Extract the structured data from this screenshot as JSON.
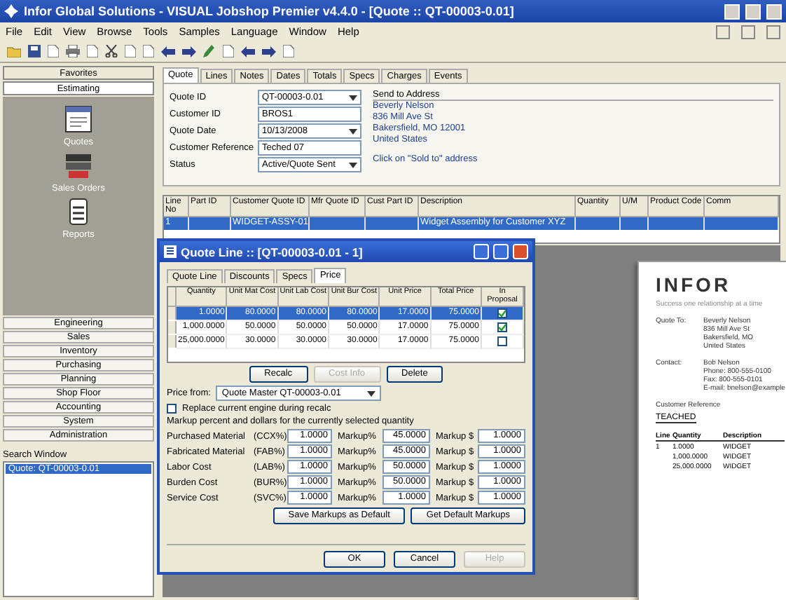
{
  "window": {
    "title": "Infor Global Solutions - VISUAL Jobshop Premier v4.4.0 - [Quote :: QT-00003-0.01]"
  },
  "menu": [
    "File",
    "Edit",
    "View",
    "Browse",
    "Tools",
    "Samples",
    "Language",
    "Window",
    "Help"
  ],
  "sidebar": {
    "headers": [
      {
        "label": "Favorites",
        "selected": false
      },
      {
        "label": "Estimating",
        "selected": true
      }
    ],
    "shortcuts": [
      "Quotes",
      "Sales Orders",
      "Reports"
    ],
    "modules": [
      "Engineering",
      "Sales",
      "Inventory",
      "Purchasing",
      "Planning",
      "Shop Floor",
      "Accounting",
      "System",
      "Administration"
    ],
    "search": {
      "title": "Search Window",
      "items": [
        {
          "label": "Quote: QT-00003-0.01",
          "selected": true
        }
      ]
    }
  },
  "main": {
    "tabs": [
      {
        "label": "Quote",
        "selected": true
      },
      {
        "label": "Lines",
        "selected": false
      },
      {
        "label": "Notes",
        "selected": false
      },
      {
        "label": "Dates",
        "selected": false
      },
      {
        "label": "Totals",
        "selected": false
      },
      {
        "label": "Specs",
        "selected": false
      },
      {
        "label": "Charges",
        "selected": false
      },
      {
        "label": "Events",
        "selected": false
      }
    ],
    "fields": [
      {
        "label": "Quote ID",
        "value": "QT-00003-0.01",
        "kind": "dropdown"
      },
      {
        "label": "Customer ID",
        "value": "BROS1",
        "kind": "text"
      },
      {
        "label": "Quote Date",
        "value": "10/13/2008",
        "kind": "dropdown"
      },
      {
        "label": "Customer Reference",
        "value": "Teched 07",
        "kind": "text"
      },
      {
        "label": "Status",
        "value": "Active/Quote Sent",
        "kind": "dropdown"
      }
    ],
    "address": {
      "title": "Send to Address",
      "lines": [
        "Beverly Nelson",
        "836 Mill Ave St",
        "Bakersfield, MO 12001",
        "United States"
      ],
      "link": "Click on \"Sold to\" address"
    },
    "grid": {
      "columns": [
        "Line No",
        "Part ID",
        "Customer Quote ID",
        "Mfr Quote ID",
        "Cust Part ID",
        "Description",
        "Quantity",
        "U/M",
        "Product Code",
        "Comm"
      ],
      "rows": [
        {
          "cells": [
            "1",
            null,
            "WIDGET-ASSY-01",
            null,
            null,
            "Widget Assembly for Customer XYZ",
            null,
            null,
            null,
            null
          ],
          "selected": true
        }
      ]
    }
  },
  "dialog": {
    "title": "Quote Line :: [QT-00003-0.01 - 1]",
    "tabs": [
      {
        "label": "Quote Line",
        "selected": false
      },
      {
        "label": "Discounts",
        "selected": false
      },
      {
        "label": "Specs",
        "selected": false
      },
      {
        "label": "Price",
        "selected": true
      }
    ],
    "columns": [
      "Quantity",
      "Unit Mat Cost",
      "Unit Lab Cost",
      "Unit Bur Cost",
      "Unit Price",
      "Total Price",
      "In Proposal"
    ],
    "rows": [
      {
        "cells": [
          "1.0000",
          "80.0000",
          "80.0000",
          "80.0000",
          "17.0000",
          "75.0000"
        ],
        "in_proposal": true,
        "selected": true
      },
      {
        "cells": [
          "1,000.0000",
          "50.0000",
          "50.0000",
          "50.0000",
          "17.0000",
          "75.0000"
        ],
        "in_proposal": true,
        "selected": false
      },
      {
        "cells": [
          "25,000.0000",
          "30.0000",
          "30.0000",
          "30.0000",
          "17.0000",
          "75.0000"
        ],
        "in_proposal": false,
        "selected": false
      }
    ],
    "table_buttons": [
      {
        "label": "Recalc",
        "disabled": false
      },
      {
        "label": "Cost Info",
        "disabled": true
      },
      {
        "label": "Delete",
        "disabled": false
      }
    ],
    "price_from": {
      "label": "Price from:",
      "value": "Quote Master QT-00003-0.01"
    },
    "replace": {
      "label": "Replace current engine during recalc",
      "checked": false
    },
    "markup_caption": "Markup percent and dollars for the currently selected quantity",
    "markups": [
      {
        "label": "Purchased Material",
        "code": "(CCX%)",
        "value": "1.0000",
        "pct_label": "Markup%",
        "pct": "45.0000",
        "amt_label": "Markup $",
        "amt": "1.0000"
      },
      {
        "label": "Fabricated Material",
        "code": "(FAB%)",
        "value": "1.0000",
        "pct_label": "Markup%",
        "pct": "45.0000",
        "amt_label": "Markup $",
        "amt": "1.0000"
      },
      {
        "label": "Labor Cost",
        "code": "(LAB%)",
        "value": "1.0000",
        "pct_label": "Markup%",
        "pct": "50.0000",
        "amt_label": "Markup $",
        "amt": "1.0000"
      },
      {
        "label": "Burden Cost",
        "code": "(BUR%)",
        "value": "1.0000",
        "pct_label": "Markup%",
        "pct": "50.0000",
        "amt_label": "Markup $",
        "amt": "1.0000"
      },
      {
        "label": "Service Cost",
        "code": "(SVC%)",
        "value": "1.0000",
        "pct_label": "Markup%",
        "pct": "1.0000",
        "amt_label": "Markup $",
        "amt": "1.0000"
      }
    ],
    "markup_buttons": [
      "Save Markups as Default",
      "Get Default Markups"
    ],
    "buttons": [
      {
        "label": "OK",
        "disabled": false
      },
      {
        "label": "Cancel",
        "disabled": false
      },
      {
        "label": "Help",
        "disabled": true
      }
    ]
  },
  "document": {
    "logo": "INFOR",
    "tagline": "Success one relationship at a time",
    "blocks": [
      {
        "label": "Quote To:",
        "lines": [
          "Beverly Nelson",
          "836 Mill Ave St",
          "Bakersfield, MO",
          "United States"
        ]
      },
      {
        "label": "Contact:",
        "lines": [
          "Bob Nelson",
          "Phone: 800-555-0100",
          "Fax: 800-555-0101",
          "E-mail: bnelson@example"
        ]
      }
    ],
    "reference_label": "Customer Reference",
    "reference": "TEACHED",
    "columns": [
      "Line",
      "Quantity",
      "Description"
    ],
    "rows": [
      [
        "1",
        "1.0000",
        "WIDGET"
      ],
      [
        null,
        "1,000.0000",
        "WIDGET"
      ],
      [
        null,
        "25,000.0000",
        "WIDGET"
      ]
    ]
  }
}
